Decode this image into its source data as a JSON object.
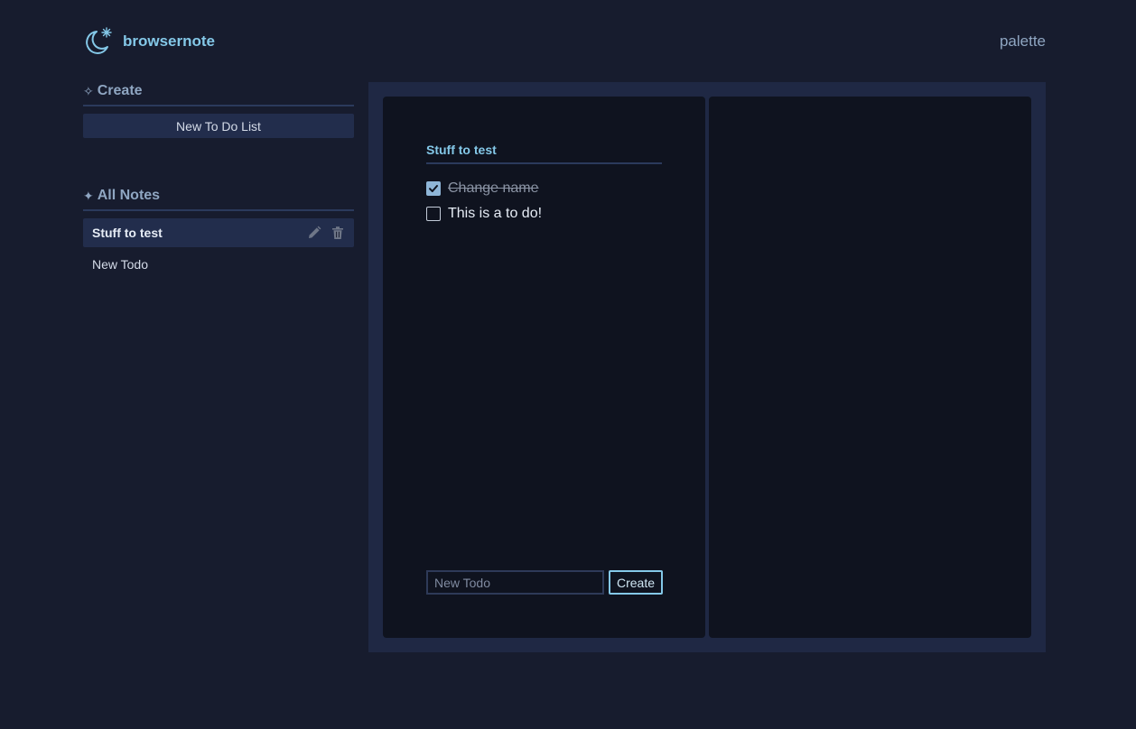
{
  "app": {
    "brand_name": "browsernote",
    "palette_label": "palette"
  },
  "colors": {
    "background": "#171c2e",
    "accent": "#84c8e8",
    "panel": "#1f2844",
    "pane": "#0f131f"
  },
  "sidebar": {
    "create": {
      "glyph": "✧",
      "heading": "Create",
      "new_list_label": "New To Do List"
    },
    "notes": {
      "glyph": "✦",
      "heading": "All Notes",
      "items": [
        {
          "label": "Stuff to test",
          "active": true
        },
        {
          "label": "New Todo",
          "active": false
        }
      ]
    }
  },
  "editor": {
    "title": "Stuff to test",
    "todos": [
      {
        "text": "Change name",
        "done": true
      },
      {
        "text": "This is a to do!",
        "done": false
      }
    ],
    "new_todo_placeholder": "New Todo",
    "create_label": "Create"
  },
  "icons": {
    "brand": "moon-star-icon",
    "edit": "pencil-icon",
    "delete": "trash-icon",
    "checked": "checkmark-icon"
  }
}
